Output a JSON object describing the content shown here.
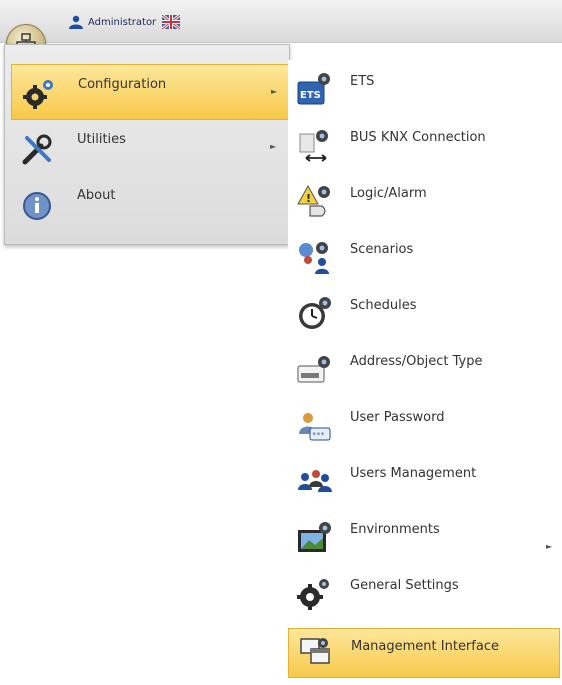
{
  "header": {
    "user_name": "Administrator"
  },
  "main_menu": {
    "items": [
      {
        "label": "Configuration",
        "icon": "gears-icon",
        "active": true,
        "has_submenu": true
      },
      {
        "label": "Utilities",
        "icon": "tools-icon",
        "active": false,
        "has_submenu": true
      },
      {
        "label": "About",
        "icon": "info-icon",
        "active": false,
        "has_submenu": false
      }
    ]
  },
  "submenu": {
    "items": [
      {
        "label": "ETS",
        "icon": "ets-icon"
      },
      {
        "label": "BUS KNX Connection",
        "icon": "bus-connection-icon"
      },
      {
        "label": "Logic/Alarm",
        "icon": "logic-alarm-icon"
      },
      {
        "label": "Scenarios",
        "icon": "scenarios-icon"
      },
      {
        "label": "Schedules",
        "icon": "schedules-icon"
      },
      {
        "label": "Address/Object Type",
        "icon": "address-object-icon"
      },
      {
        "label": "User Password",
        "icon": "user-password-icon"
      },
      {
        "label": "Users Management",
        "icon": "users-management-icon"
      },
      {
        "label": "Environments",
        "icon": "environments-icon",
        "has_submenu": true
      },
      {
        "label": "General Settings",
        "icon": "general-settings-icon"
      },
      {
        "label": "Management Interface",
        "icon": "management-interface-icon",
        "active": true
      }
    ]
  },
  "colors": {
    "highlight_top": "#fde79a",
    "highlight_bottom": "#f7c94a",
    "gear_blue": "#3a78c8"
  }
}
